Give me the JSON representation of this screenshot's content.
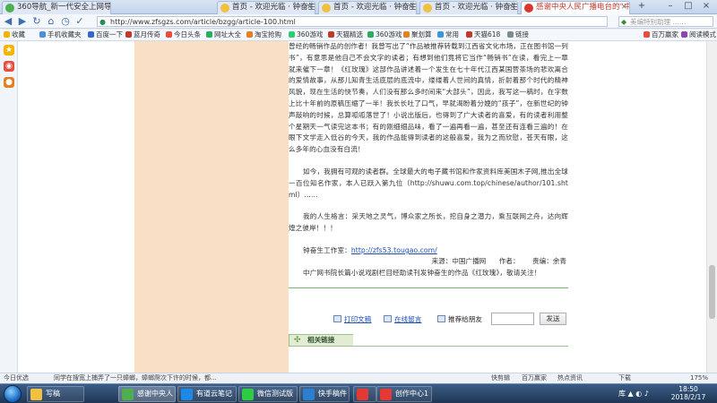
{
  "browser": {
    "tabs": [
      {
        "title": "360导航_新一代安全上网导航",
        "active": false
      },
      {
        "title": "首页 - 欢迎光临 · 钟奋生工作",
        "active": false
      },
      {
        "title": "首页 - 欢迎光临 · 钟奋生工作",
        "active": false
      },
      {
        "title": "首页 - 欢迎光临 · 钟奋生工作",
        "active": false
      },
      {
        "title": "感谢中央人民广播电台的“中国广",
        "active": true
      }
    ],
    "address": "http://www.zfsgzs.com/article/bzgg/article-100.html",
    "search_placeholder": "美编特别助理 ……",
    "ext_buttons": [
      "扩展",
      "网银",
      "翻译",
      "截图",
      "游戏",
      "登录管家"
    ],
    "bookmarks_label": "收藏",
    "bookmarks": [
      "手机收藏夹",
      "百度一下",
      "蓝月传奇",
      "今日头条",
      "网址大全",
      "淘宝抢购",
      "360游戏",
      "天猫精选",
      "360游戏",
      "聚划算",
      "常用",
      "天猫618",
      "链接"
    ],
    "bookmarks_right": [
      "百万赢家",
      "阅读模式"
    ]
  },
  "article": {
    "para1": "曾经的畅销作品的创作者！我曾写出了“作品被推荐转载到江西省文化市场，正在图书馆一列书”，有意思是他自己不会文字的读者；有想到他们竟将它当作“畅销书”在读，看完上一章就来催下一章！《红玫瑰》这部作品讲述着一个发生在七十年代江西某国营茶场的悲欢离合的爱情故事，从那儿知青生活底层的底流中，缕缕着人世间的真情，折射着那个时代的精神风貌，现在生活的快节奏，人们没有那么多时间来“大部头”，因此，我写这一稿时，在字数上比十年前的原稿压缩了一半！我长长吐了口气，早就渴盼着分娩的“孩子”，在新世纪的钟声敲响的时候，总算呱呱落世了！小说出版后，也得到了广大读者的喜爱，有的读者利用整个星期天一气读完这本书；有的刚细细品味，看了一遍再看一遍，甚至还有连看三遍的！在眼下文学走入低谷的今天，我的作品能得到读者的这般喜爱，我为之而欣慰，苍天有眼，这么多年的心血没有白流！",
    "para2": "如今，我拥有可观的读者群。全球最大的电子藏书馆和作家资料库美国木子网,推出全球一百位知名作家，本人已跃入第九位（http://shuwu.com.top/chinese/author/101.shtml）......",
    "para3": "我的人生格言：采天地之灵气，博众家之所长，挖自身之潜力，乘互联网之舟，达向辉煌之彼岸！！！",
    "para4_prefix": "钟奋生工作室：",
    "para4_link": "http://zfs53.tougao.com/",
    "para5": "中广网书院长篇小说戏剧栏目经助读刊发钟奋生的作品《红玫瑰》，敬请关注！",
    "source_line": "来源：中国广播网      作者：      责编：余青"
  },
  "actions": {
    "print": "打印文稿",
    "comment": "在线留言",
    "recommend": "推荐给朋友",
    "send": "发送"
  },
  "related_label": "相关链接",
  "statusbar": {
    "left": "今日优选",
    "news": "同学在搜宽上捕弄了一只蟑螂，蟑螂爬次下许的时候，都...",
    "right_items": [
      "快剪辑",
      "百万赢家",
      "热点资讯",
      "下载",
      "175%"
    ]
  },
  "taskbar": {
    "items": [
      "写稿",
      "感谢中央人",
      "有道云笔记",
      "微信测试版",
      "快手稿件",
      "",
      "创作中心1 ..."
    ],
    "tray_label": "库",
    "time": "18:50",
    "date": "2018/2/17"
  },
  "colors": {
    "peach_column": "#f9dfc6",
    "link": "#1a4fb4",
    "divider_green": "#7ab573"
  }
}
